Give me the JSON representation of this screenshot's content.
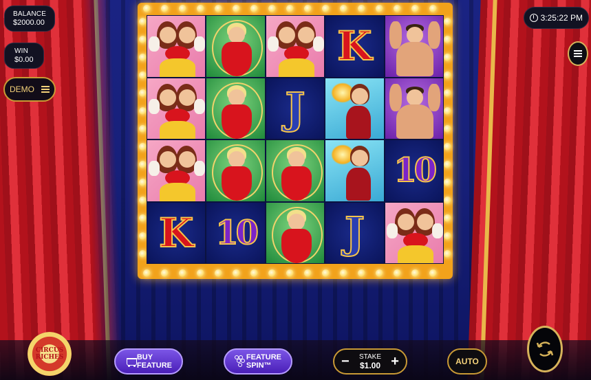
{
  "balance": {
    "label": "BALANCE",
    "value": "$2000.00"
  },
  "win": {
    "label": "WIN",
    "value": "$0.00"
  },
  "demo": {
    "label": "DEMO"
  },
  "clock": {
    "time": "3:25:22 PM"
  },
  "logo": {
    "line1": "CIRCUS",
    "line2": "RICHES"
  },
  "buttons": {
    "buy_feature": {
      "line1": "BUY",
      "line2": "FEATURE"
    },
    "feature_spin": {
      "line1": "FEATURE",
      "line2": "SPIN™"
    },
    "stake": {
      "label": "STAKE",
      "value": "$1.00",
      "minus": "−",
      "plus": "+"
    },
    "auto": "AUTO"
  },
  "reels": [
    [
      "masks",
      "marilyn",
      "masks",
      "K",
      "strongman"
    ],
    [
      "masks",
      "marilyn",
      "J",
      "fire",
      "strongman"
    ],
    [
      "masks",
      "marilyn",
      "marilyn",
      "fire",
      "10"
    ],
    [
      "K",
      "10",
      "marilyn",
      "J",
      "masks"
    ]
  ],
  "symbol_text": {
    "K": "K",
    "J": "J",
    "10": "10"
  },
  "colors": {
    "frame": "#f2a21b",
    "curtain": "#d8202a",
    "feature_button": "#5a2ad0",
    "gold_border": "#c99a35"
  }
}
